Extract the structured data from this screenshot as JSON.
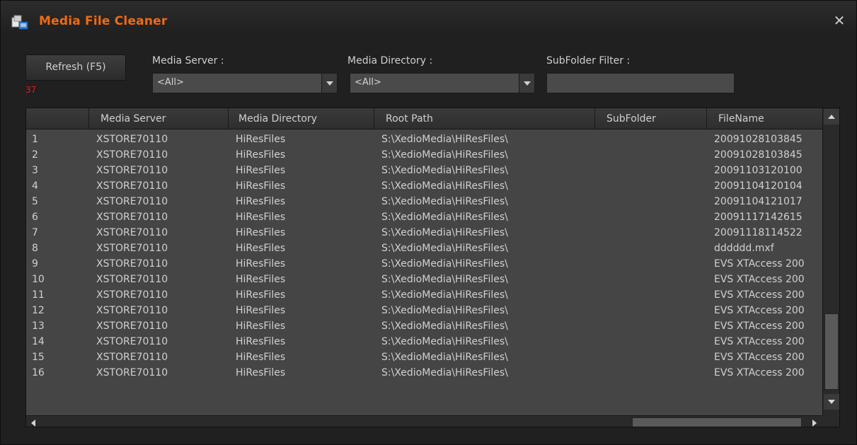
{
  "window": {
    "title": "Media File Cleaner",
    "icon": "app-icon",
    "close_icon": "close-icon",
    "title_color": "#f06a14"
  },
  "toolbar": {
    "refresh_label": "Refresh (F5)",
    "count": "37",
    "count_color": "#e01c1c",
    "media_server_label": "Media Server :",
    "media_server_value": "<All>",
    "media_directory_label": "Media Directory :",
    "media_directory_value": "<All>",
    "subfolder_filter_label": "SubFolder Filter :",
    "subfolder_filter_value": ""
  },
  "grid": {
    "columns": [
      "",
      "Media Server",
      "Media Directory",
      "Root Path",
      "SubFolder",
      "FileName"
    ],
    "rows": [
      [
        "1",
        "XSTORE70110",
        "HiResFiles",
        "S:\\XedioMedia\\HiResFiles\\",
        "",
        "20091028103845"
      ],
      [
        "2",
        "XSTORE70110",
        "HiResFiles",
        "S:\\XedioMedia\\HiResFiles\\",
        "",
        "20091028103845"
      ],
      [
        "3",
        "XSTORE70110",
        "HiResFiles",
        "S:\\XedioMedia\\HiResFiles\\",
        "",
        "20091103120100"
      ],
      [
        "4",
        "XSTORE70110",
        "HiResFiles",
        "S:\\XedioMedia\\HiResFiles\\",
        "",
        "20091104120104"
      ],
      [
        "5",
        "XSTORE70110",
        "HiResFiles",
        "S:\\XedioMedia\\HiResFiles\\",
        "",
        "20091104121017"
      ],
      [
        "6",
        "XSTORE70110",
        "HiResFiles",
        "S:\\XedioMedia\\HiResFiles\\",
        "",
        "20091117142615"
      ],
      [
        "7",
        "XSTORE70110",
        "HiResFiles",
        "S:\\XedioMedia\\HiResFiles\\",
        "",
        "20091118114522"
      ],
      [
        "8",
        "XSTORE70110",
        "HiResFiles",
        "S:\\XedioMedia\\HiResFiles\\",
        "",
        "dddddd.mxf"
      ],
      [
        "9",
        "XSTORE70110",
        "HiResFiles",
        "S:\\XedioMedia\\HiResFiles\\",
        "",
        "EVS XTAccess 200"
      ],
      [
        "10",
        "XSTORE70110",
        "HiResFiles",
        "S:\\XedioMedia\\HiResFiles\\",
        "",
        "EVS XTAccess 200"
      ],
      [
        "11",
        "XSTORE70110",
        "HiResFiles",
        "S:\\XedioMedia\\HiResFiles\\",
        "",
        "EVS XTAccess 200"
      ],
      [
        "12",
        "XSTORE70110",
        "HiResFiles",
        "S:\\XedioMedia\\HiResFiles\\",
        "",
        "EVS XTAccess 200"
      ],
      [
        "13",
        "XSTORE70110",
        "HiResFiles",
        "S:\\XedioMedia\\HiResFiles\\",
        "",
        "EVS XTAccess 200"
      ],
      [
        "14",
        "XSTORE70110",
        "HiResFiles",
        "S:\\XedioMedia\\HiResFiles\\",
        "",
        "EVS XTAccess 200"
      ],
      [
        "15",
        "XSTORE70110",
        "HiResFiles",
        "S:\\XedioMedia\\HiResFiles\\",
        "",
        "EVS XTAccess 200"
      ],
      [
        "16",
        "XSTORE70110",
        "HiResFiles",
        "S:\\XedioMedia\\HiResFiles\\",
        "",
        "EVS XTAccess 200"
      ]
    ]
  }
}
